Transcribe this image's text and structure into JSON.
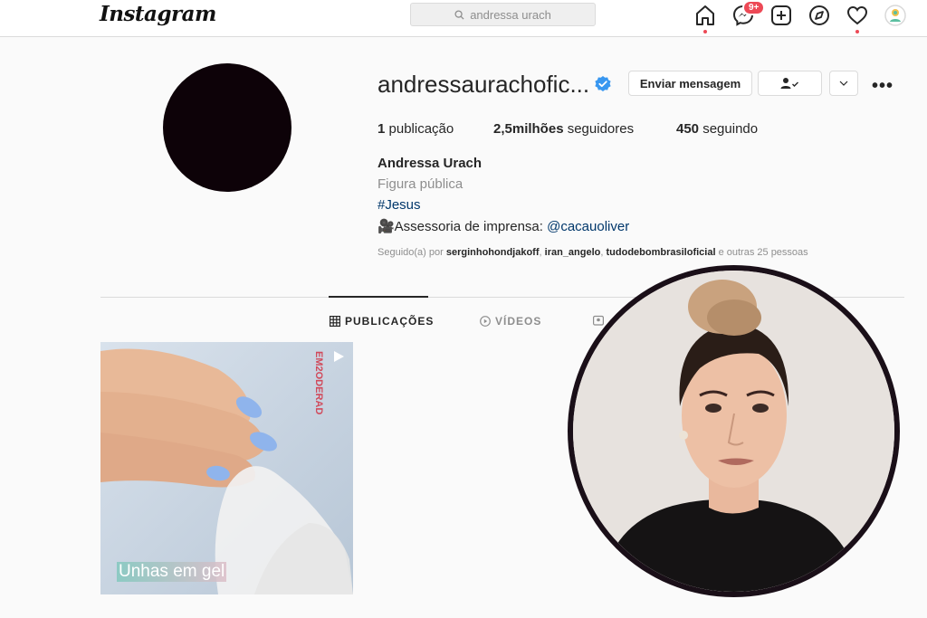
{
  "nav": {
    "logo": "Instagram",
    "search_text": "andressa urach",
    "messages_badge": "9+",
    "icons": [
      "home-icon",
      "messenger-icon",
      "new-post-icon",
      "explore-icon",
      "activity-heart-icon",
      "profile-avatar-icon"
    ]
  },
  "profile": {
    "username": "andressaurachofic...",
    "verified": true,
    "buttons": {
      "message": "Enviar mensagem",
      "more_dots": "•••"
    },
    "stats": {
      "posts_count": "1",
      "posts_label": "publicação",
      "followers_count": "2,5milhões",
      "followers_label": "seguidores",
      "following_count": "450",
      "following_label": "seguindo"
    },
    "full_name": "Andressa Urach",
    "category": "Figura pública",
    "hashtag": "#Jesus",
    "press_prefix": "🎥Assessoria de imprensa: ",
    "press_mention": "@cacauoliver",
    "followed_by": {
      "prefix": "Seguido(a) por",
      "user1": "serginhohondjakoff",
      "user2": "iran_angelo",
      "user3": "tudodebombrasiloficial",
      "suffix": "e outras 25 pessoas"
    }
  },
  "tabs": [
    {
      "label": "PUBLICAÇÕES",
      "active": true
    },
    {
      "label": "VÍDEOS",
      "active": false
    }
  ],
  "posts": [
    {
      "caption": "Unhas em gel",
      "type": "video"
    }
  ],
  "colors": {
    "link": "#00376b",
    "verified_blue": "#3897f0",
    "badge_red": "#ed4956",
    "border": "#dbdbdb"
  }
}
